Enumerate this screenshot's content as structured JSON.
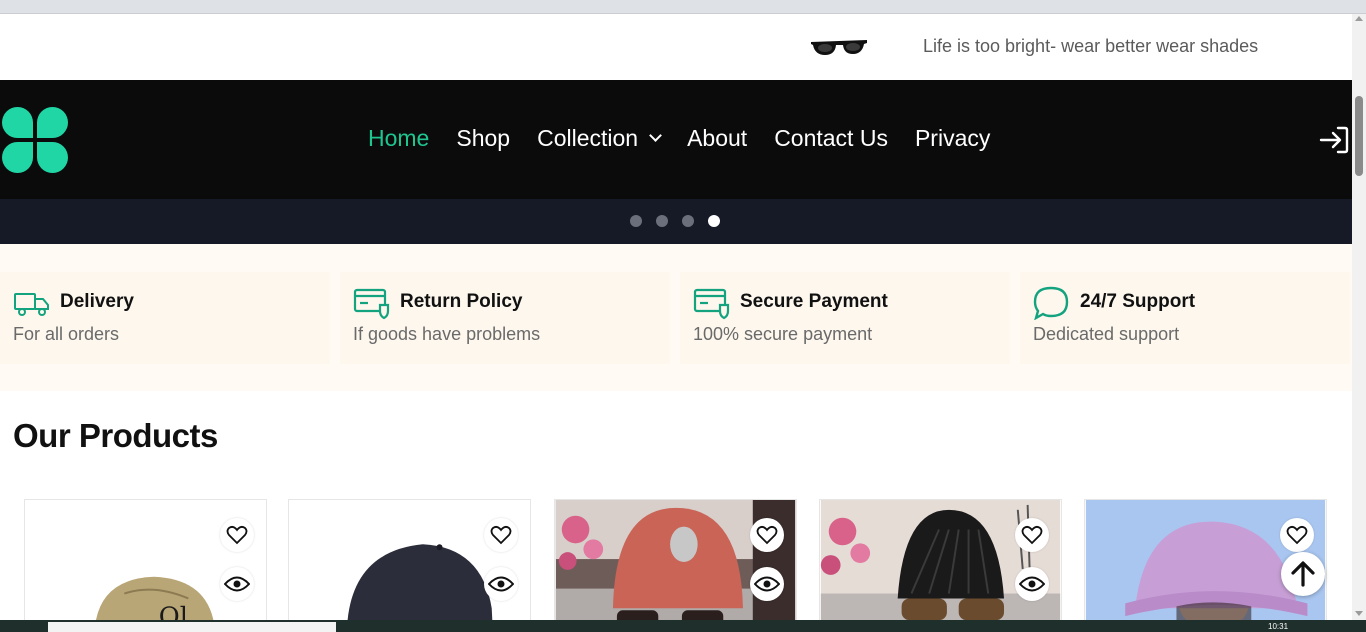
{
  "announcement": {
    "icon": "sunglasses-icon",
    "message": "Life is too bright- wear better wear shades"
  },
  "navbar": {
    "links": [
      "Home",
      "Shop",
      "Collection",
      "About",
      "Contact Us",
      "Privacy"
    ],
    "active": "Home",
    "accent_color": "#1fc58f",
    "login_icon": "login-icon"
  },
  "slider": {
    "total_dots": 4,
    "active_index": 4
  },
  "features": [
    {
      "icon": "truck-icon",
      "title": "Delivery",
      "subtitle": "For all orders"
    },
    {
      "icon": "return-card-icon",
      "title": "Return Policy",
      "subtitle": "If goods have problems"
    },
    {
      "icon": "secure-card-icon",
      "title": "Secure Payment",
      "subtitle": "100% secure payment"
    },
    {
      "icon": "chat-bubble-icon",
      "title": "24/7 Support",
      "subtitle": "Dedicated support"
    }
  ],
  "products_section": {
    "title": "Our Products",
    "cards": [
      {
        "image": "khaki-cap"
      },
      {
        "image": "black-cap"
      },
      {
        "image": "knit-turban-sunglasses"
      },
      {
        "image": "visor-sunglasses"
      },
      {
        "image": "pink-bucket-hat"
      }
    ]
  },
  "taskbar": {
    "time": "10:31"
  }
}
